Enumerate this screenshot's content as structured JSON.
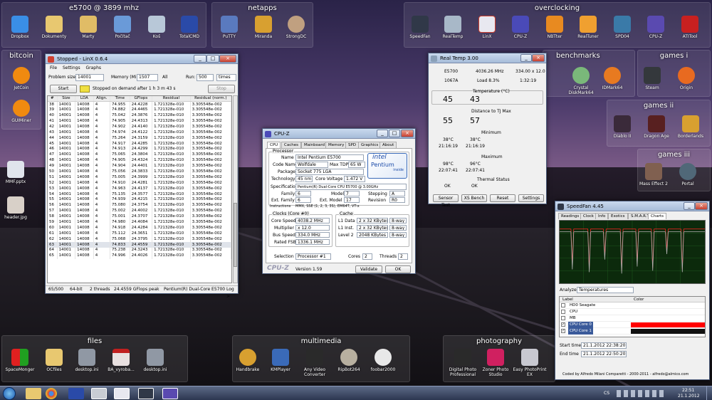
{
  "fences": {
    "f1": {
      "title": "e5700 @ 3899 mhz",
      "icons": [
        "Dropbox",
        "Dokumenty",
        "Marty",
        "Počítač",
        "Koš",
        "TotalCMD"
      ]
    },
    "f2": {
      "title": "netapps",
      "icons": [
        "PuTTY",
        "Miranda",
        "StrongDC"
      ]
    },
    "f3": {
      "title": "overclocking",
      "icons": [
        "SpeedFan",
        "RealTemp",
        "LinX",
        "CPU-Z",
        "NBTter",
        "RealTuner",
        "SPD04",
        "CPU-Z",
        "ATITool"
      ]
    },
    "f4": {
      "title": "bitcoin",
      "icons": [
        "JetCoin",
        "GUIMiner"
      ]
    },
    "f5": {
      "title": "benchmarks",
      "icons": [
        "Crystal DiskMark64",
        "IDMark64"
      ]
    },
    "f6": {
      "title": "games i",
      "icons": [
        "Steam",
        "Origin"
      ]
    },
    "f7": {
      "title": "games ii",
      "icons": [
        "Diablo II",
        "Dragon Age",
        "Borderlands"
      ]
    },
    "f8": {
      "title": "games iii",
      "icons": [
        "Mass Effect 2",
        "Portal"
      ]
    },
    "f9": {
      "title": "files",
      "icons": [
        "SpaceMonger",
        "OCfiles",
        "desktop.ini",
        "BA_vyroba...",
        "desktop.ini"
      ]
    },
    "f10": {
      "title": "multimedia",
      "icons": [
        "Handbrake",
        "KMPlayer",
        "Any Video Converter",
        "RipBot264",
        "foobar2000"
      ]
    },
    "f11": {
      "title": "photography",
      "icons": [
        "Digital Photo Professional",
        "Zoner Photo Studio",
        "Easy PhotoPrint EX"
      ]
    },
    "loose": [
      "MMF.pptx",
      "header.jpg"
    ]
  },
  "linx": {
    "title": "Stopped - LinX 0.6.4",
    "menu": [
      "File",
      "Settings",
      "Graphs"
    ],
    "problem_label": "Problem size:",
    "problem_value": "14001",
    "memory_label": "Memory (MiB):",
    "memory_value": "1507",
    "all_label": "All",
    "run_label": "Run:",
    "run_value": "500",
    "times_label": "times",
    "start": "Start",
    "status": "Stopped on demand after 1 h 3 m 43 s",
    "stop": "Stop",
    "headers": [
      "#",
      "Size",
      "LDA",
      "Align.",
      "Time",
      "GFlops",
      "Residual",
      "Residual (norm.)"
    ],
    "rows": [
      [
        "38",
        "14001",
        "14008",
        "4",
        "74.955",
        "24.4228",
        "1.721328e-010",
        "3.305548e-002"
      ],
      [
        "39",
        "14001",
        "14008",
        "4",
        "74.882",
        "24.4465",
        "1.721328e-010",
        "3.305548e-002"
      ],
      [
        "40",
        "14001",
        "14008",
        "4",
        "75.042",
        "24.3876",
        "1.721328e-010",
        "3.305548e-002"
      ],
      [
        "41",
        "14001",
        "14008",
        "4",
        "74.905",
        "24.4313",
        "1.721328e-010",
        "3.305548e-002"
      ],
      [
        "42",
        "14001",
        "14008",
        "4",
        "74.902",
        "24.4140",
        "1.721328e-010",
        "3.305548e-002"
      ],
      [
        "43",
        "14001",
        "14008",
        "4",
        "74.974",
        "24.4122",
        "1.721328e-010",
        "3.305548e-002"
      ],
      [
        "44",
        "14001",
        "14008",
        "4",
        "75.264",
        "24.3159",
        "1.721328e-010",
        "3.305548e-002"
      ],
      [
        "45",
        "14001",
        "14008",
        "4",
        "74.917",
        "24.4285",
        "1.721328e-010",
        "3.305548e-002"
      ],
      [
        "46",
        "14001",
        "14008",
        "4",
        "74.913",
        "24.4299",
        "1.721328e-010",
        "3.305548e-002"
      ],
      [
        "47",
        "14001",
        "14008",
        "4",
        "75.065",
        "24.3804",
        "1.721328e-010",
        "3.305548e-002"
      ],
      [
        "48",
        "14001",
        "14008",
        "4",
        "74.905",
        "24.4324",
        "1.721328e-010",
        "3.305548e-002"
      ],
      [
        "49",
        "14001",
        "14008",
        "4",
        "74.904",
        "24.4401",
        "1.721328e-010",
        "3.305548e-002"
      ],
      [
        "50",
        "14001",
        "14008",
        "4",
        "75.056",
        "24.3833",
        "1.721328e-010",
        "3.305548e-002"
      ],
      [
        "51",
        "14001",
        "14008",
        "4",
        "75.005",
        "24.3999",
        "1.721328e-010",
        "3.305548e-002"
      ],
      [
        "52",
        "14001",
        "14008",
        "4",
        "74.910",
        "24.4281",
        "1.721328e-010",
        "3.305548e-002"
      ],
      [
        "53",
        "14001",
        "14008",
        "4",
        "74.963",
        "24.4137",
        "1.721328e-010",
        "3.305548e-002"
      ],
      [
        "54",
        "14001",
        "14008",
        "4",
        "75.135",
        "24.3577",
        "1.721328e-010",
        "3.305548e-002"
      ],
      [
        "55",
        "14001",
        "14008",
        "4",
        "74.939",
        "24.4215",
        "1.721328e-010",
        "3.305548e-002"
      ],
      [
        "56",
        "14001",
        "14008",
        "4",
        "75.080",
        "24.3754",
        "1.721328e-010",
        "3.305548e-002"
      ],
      [
        "57",
        "14001",
        "14008",
        "4",
        "75.002",
        "24.4002",
        "1.721328e-010",
        "3.305548e-002"
      ],
      [
        "58",
        "14001",
        "14008",
        "4",
        "75.001",
        "24.3707",
        "1.721328e-010",
        "3.305548e-002"
      ],
      [
        "59",
        "14001",
        "14008",
        "4",
        "74.980",
        "24.4084",
        "1.721328e-010",
        "3.305548e-002"
      ],
      [
        "60",
        "14001",
        "14008",
        "4",
        "74.918",
        "24.4284",
        "1.721328e-010",
        "3.305548e-002"
      ],
      [
        "61",
        "14001",
        "14008",
        "4",
        "75.112",
        "24.3651",
        "1.721328e-010",
        "3.305548e-002"
      ],
      [
        "62",
        "14001",
        "14008",
        "4",
        "75.068",
        "24.3795",
        "1.721328e-010",
        "3.305548e-002"
      ],
      [
        "63",
        "14001",
        "14008",
        "4",
        "74.833",
        "24.4559",
        "1.721328e-010",
        "3.305548e-002"
      ],
      [
        "64",
        "14001",
        "14008",
        "4",
        "75.238",
        "24.3243",
        "1.721328e-010",
        "3.305548e-002"
      ],
      [
        "65",
        "14001",
        "14008",
        "4",
        "74.996",
        "24.4026",
        "1.721328e-010",
        "3.305548e-002"
      ]
    ],
    "status_bar": [
      "65/500",
      "64-bit",
      "2 threads",
      "24.4559 GFlops peak",
      "Pentium(R) Dual-Core E5700",
      "Log >"
    ]
  },
  "realtemp": {
    "title": "Real Temp 3.00",
    "cpu": "E5700",
    "mhz": "4036.26 MHz",
    "ratio": "334.00 x 12.0",
    "vid": "1067A",
    "load": "Load  8.3%",
    "time": "1:32:19",
    "temp_label": "Temperature (°C)",
    "t1": "45",
    "t2": "43",
    "dist_label": "Distance to TJ Max",
    "d1": "55",
    "d2": "57",
    "min_label": "Minimum",
    "min1": "38°C",
    "min2": "38°C",
    "min_t1": "21:16:19",
    "min_t2": "21:16:19",
    "max_label": "Maximum",
    "max1": "98°C",
    "max2": "96°C",
    "max_t1": "22:07:41",
    "max_t2": "22:07:41",
    "thermal_label": "Thermal Status",
    "ok1": "OK",
    "ok2": "OK",
    "buttons": [
      "Sensor Test",
      "XS Bench",
      "Reset",
      "Settings"
    ]
  },
  "cpuz": {
    "title": "CPU-Z",
    "tabs": [
      "CPU",
      "Caches",
      "Mainboard",
      "Memory",
      "SPD",
      "Graphics",
      "About"
    ],
    "processor_label": "Processor",
    "name_l": "Name",
    "name": "Intel Pentium E5700",
    "code_l": "Code Name",
    "code": "Wolfdale",
    "tdp_l": "Max TDP",
    "tdp": "65 W",
    "pkg_l": "Package",
    "pkg": "Socket 775 LGA",
    "tech_l": "Technology",
    "tech": "45 nm",
    "volt_l": "Core Voltage",
    "volt": "1.472 V",
    "spec_l": "Specification",
    "spec": "Pentium(R) Dual-Core  CPU    E5700  @ 3.00GHz",
    "fam_l": "Family",
    "fam": "6",
    "model_l": "Model",
    "model": "7",
    "step_l": "Stepping",
    "step": "A",
    "efam_l": "Ext. Family",
    "efam": "6",
    "emodel_l": "Ext. Model",
    "emodel": "17",
    "rev_l": "Revision",
    "rev": "R0",
    "instr_l": "Instructions",
    "instr": "MMX, SSE (1, 2, 3, 3S), EM64T, VT-x",
    "clocks_l": "Clocks (Core #0)",
    "cs_l": "Core Speed",
    "cs": "4038.2 MHz",
    "mul_l": "Multiplier",
    "mul": "x 12.0",
    "bus_l": "Bus Speed",
    "bus": "334.0 MHz",
    "fsb_l": "Rated FSB",
    "fsb": "1336.1 MHz",
    "cache_l": "Cache",
    "l1d_l": "L1 Data",
    "l1d": "2 x 32 KBytes",
    "l1d_w": "8-way",
    "l1i_l": "L1 Inst.",
    "l1i": "2 x 32 KBytes",
    "l1i_w": "8-way",
    "l2_l": "Level 2",
    "l2": "2048 KBytes",
    "l2_w": "8-way",
    "sel_l": "Selection",
    "sel": "Processor #1",
    "cores_l": "Cores",
    "cores": "2",
    "thr_l": "Threads",
    "thr": "2",
    "brand": "CPU-Z",
    "version": "Version 1.59",
    "validate": "Validate",
    "ok": "OK",
    "intel": "intel",
    "pentium": "Pentium",
    "inside": "inside"
  },
  "speedfan": {
    "title": "SpeedFan 4.45",
    "tabs": [
      "Readings",
      "Clock",
      "Info",
      "Exotics",
      "S.M.A.R.T.",
      "Charts"
    ],
    "analyze_l": "Analyze",
    "analyze": "Temperatures",
    "col_label": "Label",
    "col_color": "Color",
    "items": [
      {
        "label": "HD0 Seagate",
        "color": "#ffffff",
        "checked": false
      },
      {
        "label": "CPU",
        "color": "#ffffff",
        "checked": false
      },
      {
        "label": "MB",
        "color": "#ffffff",
        "checked": false
      },
      {
        "label": "CPU Core 0",
        "color": "#ff0000",
        "checked": true
      },
      {
        "label": "CPU Core 1",
        "color": "#111111",
        "checked": true
      }
    ],
    "start_l": "Start time",
    "start": "21.1.2012 22:38:20",
    "end_l": "End time",
    "end": "21.1.2012 22:50:20",
    "footer": "Coded by Alfredo Milani Comparetti - 2000-2011 - alfredo@almico.com"
  },
  "taskbar": {
    "lang": "CS",
    "time": "22:51",
    "date": "21.1.2012"
  },
  "colors": {
    "accent": "#3a7bd5",
    "chart_bg": "#0c2a0c",
    "chart_line": "#00cc33",
    "core0": "#ff0000"
  }
}
